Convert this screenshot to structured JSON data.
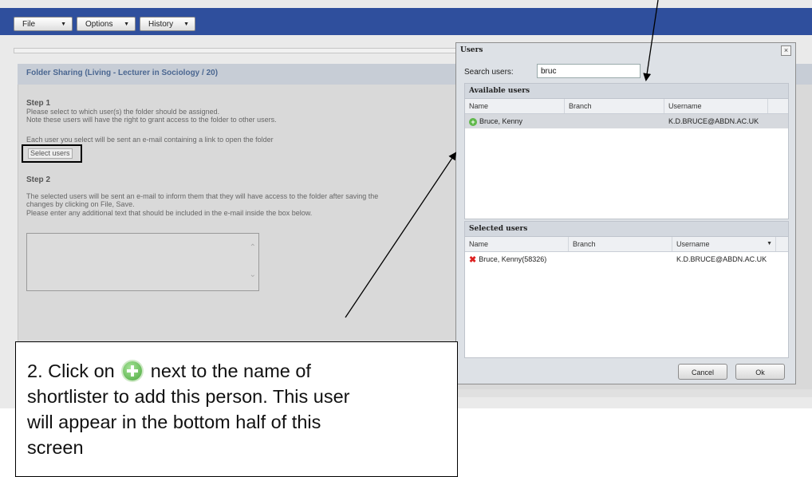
{
  "toolbar": {
    "file_label": "File",
    "options_label": "Options",
    "history_label": "History"
  },
  "folder_panel": {
    "title": "Folder Sharing (Living - Lecturer in Sociology / 20)",
    "step1_title": "Step 1",
    "step1_lines": [
      "Please select to which user(s) the folder should be assigned.",
      "Note these users will have the right to grant access to the folder to other users."
    ],
    "step1_email_note": "Each user you select will be sent an e-mail containing a link to open the folder",
    "select_users_label": "Select users",
    "step2_title": "Step 2",
    "step2_lines": [
      "The selected users will be sent an e-mail to inform them that they will have access to the folder after saving the",
      "changes by clicking on File, Save.",
      "Please enter any additional text that should be included in the e-mail inside the box below."
    ]
  },
  "users_dialog": {
    "title": "Users",
    "close_symbol": "×",
    "search_label": "Search users:",
    "search_value": "bruc",
    "available_title": "Available users",
    "selected_title": "Selected users",
    "columns": [
      "Name",
      "Branch",
      "Username"
    ],
    "available_rows": [
      {
        "name": "Bruce, Kenny",
        "branch": "",
        "username": "K.D.BRUCE@ABDN.AC.UK"
      }
    ],
    "selected_rows": [
      {
        "name": "Bruce, Kenny(58326)",
        "branch": "",
        "username": "K.D.BRUCE@ABDN.AC.UK"
      }
    ],
    "cancel_label": "Cancel",
    "ok_label": "Ok"
  },
  "callout": {
    "line1_before_icon": "2. Click on",
    "line1_after_icon": "next to the name of",
    "line2": "shortlister to add this person. This user",
    "line3": "will appear in the bottom half of this",
    "line4": "screen",
    "icon": "green-plus-icon"
  },
  "colors": {
    "toolbar_bg": "#2f4f9d",
    "panel_title": "#4b6791",
    "add_icon": "#5fb84a",
    "remove_icon": "#dd2222"
  }
}
